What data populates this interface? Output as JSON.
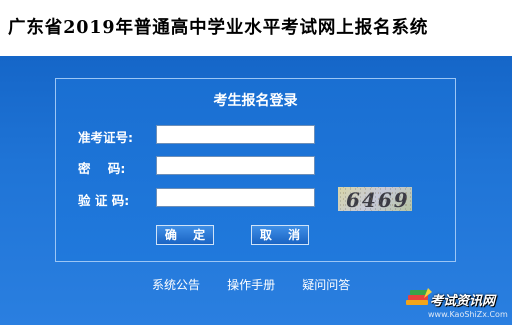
{
  "header": {
    "title": "广东省2019年普通高中学业水平考试网上报名系统"
  },
  "login": {
    "title": "考生报名登录",
    "fields": [
      {
        "label": "准考证号:",
        "value": ""
      },
      {
        "label": "密    码:",
        "value": ""
      },
      {
        "label": "验 证 码:",
        "value": ""
      }
    ],
    "captcha_text": "6469",
    "confirm_label": "确 定",
    "cancel_label": "取 消"
  },
  "footer": {
    "links": [
      "系统公告",
      "操作手册",
      "疑问问答"
    ]
  },
  "watermark": {
    "name": "考试资讯网",
    "url": "www.KaoShiZx.Com"
  },
  "colors": {
    "background": "#1f74d6",
    "panel_border": "#9cc6f5",
    "text": "#ffffff"
  }
}
